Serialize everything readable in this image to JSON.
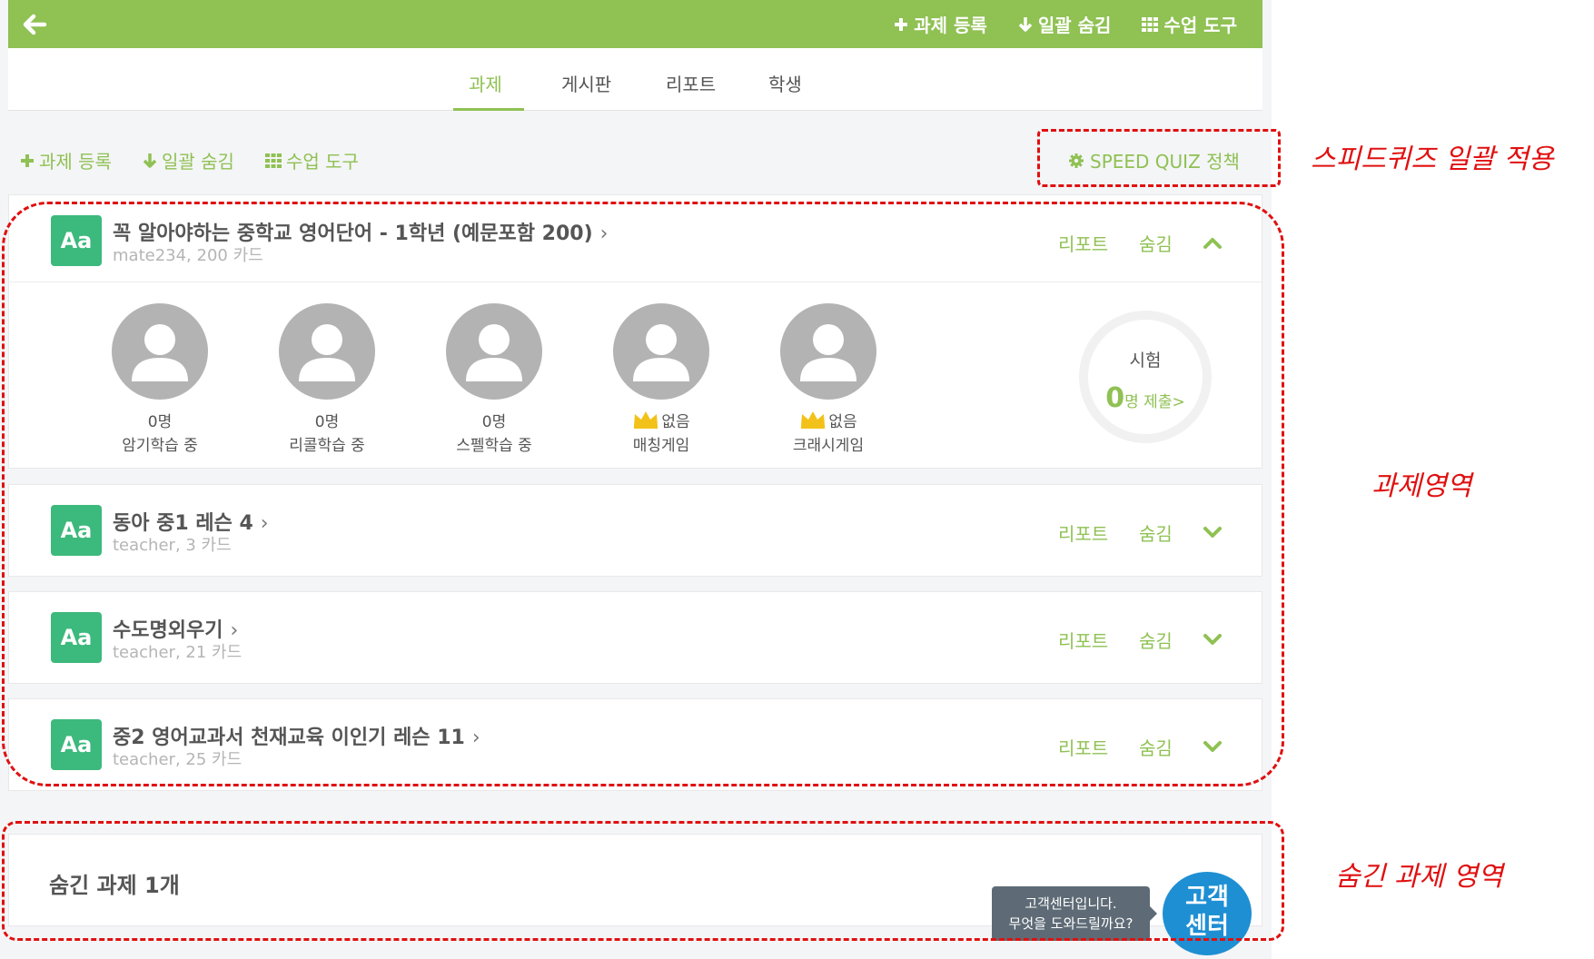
{
  "header": {
    "actions": [
      {
        "label": "과제 등록",
        "icon": "plus-icon"
      },
      {
        "label": "일괄 숨김",
        "icon": "arrow-down-icon"
      },
      {
        "label": "수업 도구",
        "icon": "grid-icon"
      }
    ]
  },
  "tabs": [
    {
      "label": "과제",
      "active": true
    },
    {
      "label": "게시판",
      "active": false
    },
    {
      "label": "리포트",
      "active": false
    },
    {
      "label": "학생",
      "active": false
    }
  ],
  "toolbar": {
    "actions": [
      {
        "label": "과제 등록",
        "icon": "plus-icon"
      },
      {
        "label": "일괄 숨김",
        "icon": "arrow-down-icon"
      },
      {
        "label": "수업 도구",
        "icon": "grid-icon"
      }
    ],
    "speed_quiz_label": "SPEED QUIZ 정책"
  },
  "assignments": [
    {
      "badge": "Aa",
      "title": "꼭 알아야하는 중학교 영어단어 - 1학년 (예문포함 200)",
      "subtitle": "mate234, 200 카드",
      "report_label": "리포트",
      "hide_label": "숨김",
      "expanded": true
    },
    {
      "badge": "Aa",
      "title": "동아 중1 레슨 4",
      "subtitle": "teacher, 3 카드",
      "report_label": "리포트",
      "hide_label": "숨김",
      "expanded": false
    },
    {
      "badge": "Aa",
      "title": "수도명외우기",
      "subtitle": "teacher, 21 카드",
      "report_label": "리포트",
      "hide_label": "숨김",
      "expanded": false
    },
    {
      "badge": "Aa",
      "title": "중2 영어교과서 천재교육 이인기 레슨 11",
      "subtitle": "teacher, 25 카드",
      "report_label": "리포트",
      "hide_label": "숨김",
      "expanded": false
    }
  ],
  "stats": [
    {
      "value": "0명",
      "label": "암기학습 중",
      "crown": false
    },
    {
      "value": "0명",
      "label": "리콜학습 중",
      "crown": false
    },
    {
      "value": "0명",
      "label": "스펠학습 중",
      "crown": false
    },
    {
      "value": "없음",
      "label": "매칭게임",
      "crown": true
    },
    {
      "value": "없음",
      "label": "크래시게임",
      "crown": true
    }
  ],
  "exam": {
    "title": "시험",
    "count": "0",
    "count_suffix": "명 제출>"
  },
  "hidden_section": {
    "title": "숨긴 과제 1개"
  },
  "support": {
    "tooltip_line1": "고객센터입니다.",
    "tooltip_line2": "무엇을 도와드릴까요?",
    "button_line1": "고객",
    "button_line2": "센터"
  },
  "annotations": {
    "speed_quiz": "스피드퀴즈 일괄 적용",
    "assignment_area": "과제영역",
    "hidden_area": "숨긴 과제 영역"
  },
  "colors": {
    "brand_green": "#8fc153",
    "badge_green": "#3cb97c",
    "annotation_red": "#e01010",
    "support_blue": "#1e8fd3"
  }
}
